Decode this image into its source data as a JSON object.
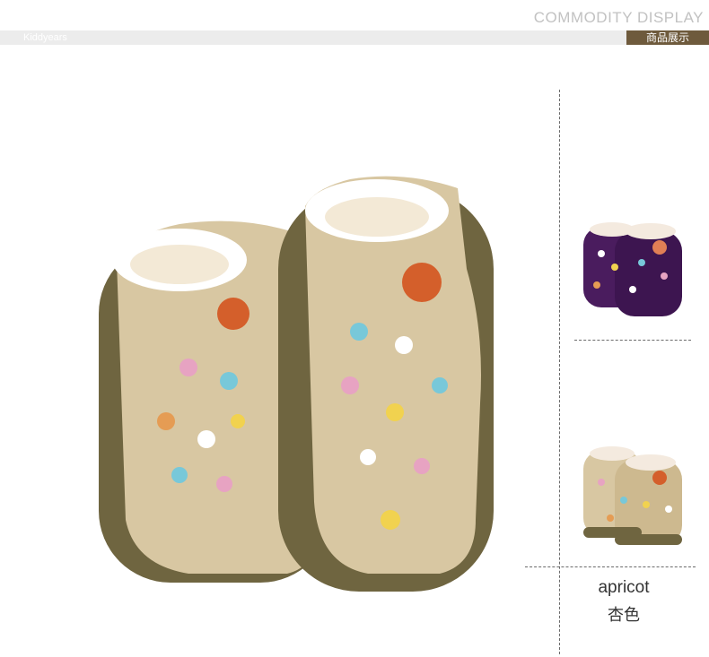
{
  "header": {
    "title": "COMMODITY DISPLAY",
    "brand": "Kiddyears",
    "cn_tag": "商品展示"
  },
  "main_image": {
    "alt": "Pair of apricot suede fleece-lined boots with colorful flower prints",
    "icon": "boots-photo"
  },
  "variants": [
    {
      "name": "purple",
      "color": "#4a1c5e",
      "selected": false
    },
    {
      "name": "apricot",
      "name_cn": "杏色",
      "color": "#d8c7a2",
      "selected": true
    }
  ],
  "label": {
    "name": "apricot",
    "name_cn": "杏色"
  },
  "colors": {
    "apricot": "#d8c7a2",
    "sole": "#6f6540",
    "purple": "#4a1c5e",
    "accent_bar": "#ececec",
    "tag_bg": "#6e5a3c"
  }
}
